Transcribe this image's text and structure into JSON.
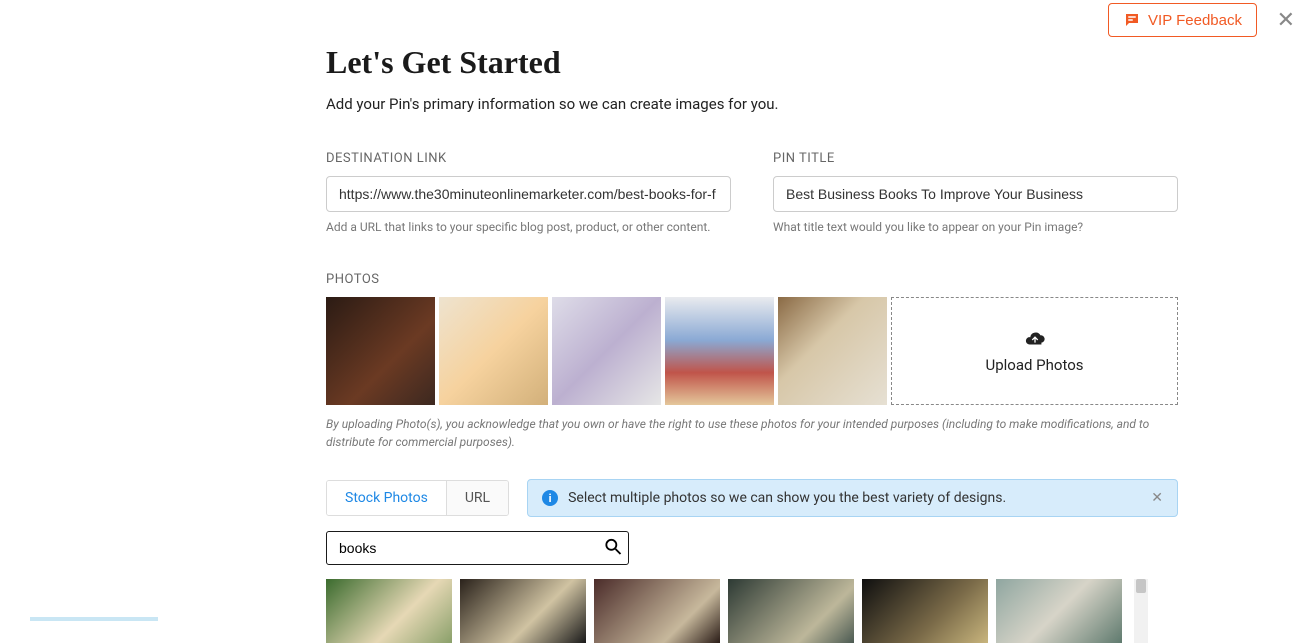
{
  "feedback_label": "VIP Feedback",
  "header": {
    "title": "Let's Get Started",
    "subtitle": "Add your Pin's primary information so we can create images for you."
  },
  "fields": {
    "destination_link": {
      "label": "DESTINATION LINK",
      "value": "https://www.the30minuteonlinemarketer.com/best-books-for-f",
      "helper": "Add a URL that links to your specific blog post, product, or other content."
    },
    "pin_title": {
      "label": "PIN TITLE",
      "value": "Best Business Books To Improve Your Business",
      "helper": "What title text would you like to appear on your Pin image?"
    }
  },
  "photos": {
    "label": "PHOTOS",
    "upload_label": "Upload Photos",
    "disclaimer": "By uploading Photo(s), you acknowledge that you own or have the right to use these photos for your intended purposes (including to make modifications, and to distribute for commercial purposes)."
  },
  "tabs": {
    "stock_photos": "Stock Photos",
    "url": "URL"
  },
  "tip": "Select multiple photos so we can show you the best variety of designs.",
  "search": {
    "value": "books"
  }
}
